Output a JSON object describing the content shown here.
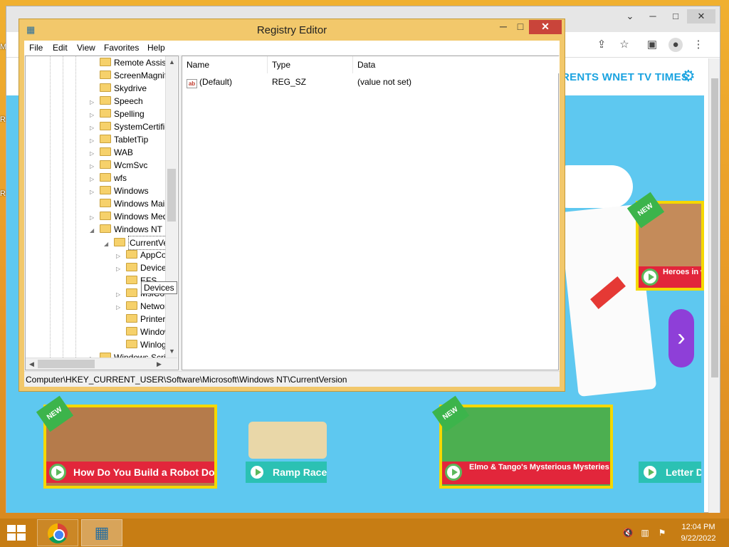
{
  "desktop": {
    "fragments": [
      "M",
      "R",
      "R"
    ]
  },
  "chrome": {
    "window_controls": {
      "minimize": "─",
      "maximize": "□",
      "close": "✕",
      "tab_search": "⌄"
    },
    "toolbar_icons": [
      "share-icon",
      "bookmark-star-icon",
      "side-panel-icon",
      "profile-icon",
      "more-menu-icon"
    ],
    "page": {
      "header_link": "RENTS  WNET TV TIMES",
      "tiles": [
        {
          "label": "How Do You Build a Robot Dog",
          "badge": "NEW"
        },
        {
          "label": "Ramp Racers"
        },
        {
          "label": "Elmo & Tango's Mysterious Mysteries Wheels",
          "badge": "NEW"
        },
        {
          "label": "Letter D"
        },
        {
          "label": "Heroes in with Jon B",
          "badge": "NEW"
        }
      ],
      "next_arrow": "›"
    }
  },
  "regedit": {
    "title": "Registry Editor",
    "controls": {
      "minimize": "─",
      "maximize": "□",
      "close": "✕"
    },
    "menu": [
      "File",
      "Edit",
      "View",
      "Favorites",
      "Help"
    ],
    "tree": [
      {
        "label": "Remote Assista",
        "expander": "",
        "level": 1
      },
      {
        "label": "ScreenMagnifi",
        "expander": "",
        "level": 1
      },
      {
        "label": "Skydrive",
        "expander": "",
        "level": 1
      },
      {
        "label": "Speech",
        "expander": "▷",
        "level": 1
      },
      {
        "label": "Spelling",
        "expander": "▷",
        "level": 1
      },
      {
        "label": "SystemCertific",
        "expander": "▷",
        "level": 1
      },
      {
        "label": "TabletTip",
        "expander": "▷",
        "level": 1
      },
      {
        "label": "WAB",
        "expander": "▷",
        "level": 1
      },
      {
        "label": "WcmSvc",
        "expander": "▷",
        "level": 1
      },
      {
        "label": "wfs",
        "expander": "▷",
        "level": 1
      },
      {
        "label": "Windows",
        "expander": "▷",
        "level": 1
      },
      {
        "label": "Windows Mail",
        "expander": "",
        "level": 1
      },
      {
        "label": "Windows Med",
        "expander": "▷",
        "level": 1
      },
      {
        "label": "Windows NT",
        "expander": "◢",
        "level": 1
      },
      {
        "label": "CurrentVer",
        "expander": "◢",
        "level": 2,
        "selected": true
      },
      {
        "label": "AppCo",
        "expander": "▷",
        "level": 3
      },
      {
        "label": "Devices",
        "expander": "▷",
        "level": 3
      },
      {
        "label": "EFS",
        "expander": "",
        "level": 3
      },
      {
        "label": "MsiCor",
        "expander": "▷",
        "level": 3
      },
      {
        "label": "Networ",
        "expander": "▷",
        "level": 3
      },
      {
        "label": "PrinterP",
        "expander": "",
        "level": 3
      },
      {
        "label": "Window",
        "expander": "",
        "level": 3
      },
      {
        "label": "Winlog",
        "expander": "",
        "level": 3
      },
      {
        "label": "Windows Scri",
        "expander": "▷",
        "level": 1
      }
    ],
    "tooltip": "Devices",
    "columns": [
      "Name",
      "Type",
      "Data"
    ],
    "values": [
      {
        "name": "(Default)",
        "type": "REG_SZ",
        "data": "(value not set)",
        "icon": "ab"
      }
    ],
    "status": "Computer\\HKEY_CURRENT_USER\\Software\\Microsoft\\Windows NT\\CurrentVersion"
  },
  "taskbar": {
    "apps": [
      "Google Chrome",
      "Registry Editor"
    ],
    "tray_icons": [
      "volume-muted-icon",
      "network-icon",
      "action-center-icon"
    ],
    "clock": {
      "time": "12:04 PM",
      "date": "9/22/2022"
    }
  }
}
